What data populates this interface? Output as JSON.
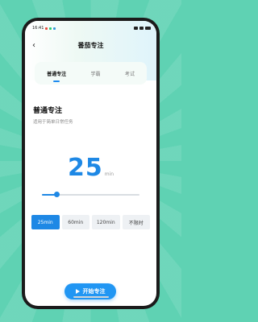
{
  "status": {
    "time": "16:41"
  },
  "header": {
    "back_glyph": "‹",
    "title": "番茄专注"
  },
  "tabs": [
    {
      "label": "普通专注",
      "active": true
    },
    {
      "label": "学霸",
      "active": false
    },
    {
      "label": "考试",
      "active": false
    }
  ],
  "mode": {
    "title": "普通专注",
    "subtitle": "适用于简单日常任务"
  },
  "timer": {
    "value": "25",
    "unit": "min"
  },
  "slider": {
    "value_fraction": 0.15
  },
  "presets": [
    {
      "label": "25min",
      "active": true
    },
    {
      "label": "60min",
      "active": false
    },
    {
      "label": "120min",
      "active": false
    },
    {
      "label": "不限时",
      "active": false
    }
  ],
  "start_button": {
    "label": "开始专注"
  },
  "colors": {
    "accent": "#1e88e5",
    "background": "#5fd2b3"
  }
}
